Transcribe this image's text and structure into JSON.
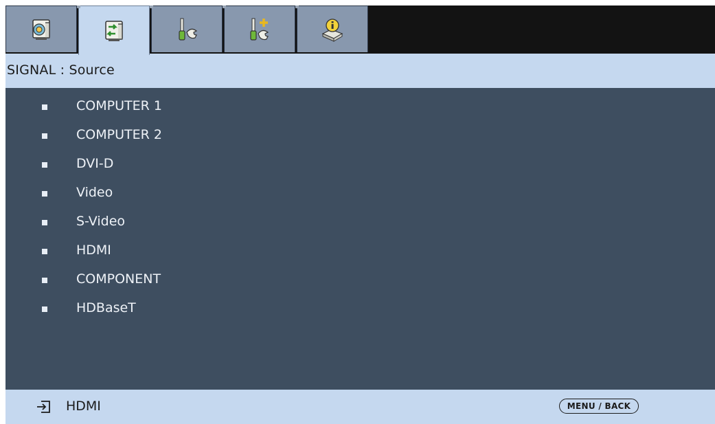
{
  "tabs": [
    {
      "name": "tab-image",
      "icon": "image-settings-icon",
      "active": false
    },
    {
      "name": "tab-signal",
      "icon": "signal-settings-icon",
      "active": true
    },
    {
      "name": "tab-setup",
      "icon": "setup-tools-icon",
      "active": false
    },
    {
      "name": "tab-extended",
      "icon": "extended-setup-icon",
      "active": false
    },
    {
      "name": "tab-information",
      "icon": "information-icon",
      "active": false
    }
  ],
  "header": {
    "title": "SIGNAL : Source"
  },
  "sources": [
    {
      "label": "COMPUTER 1"
    },
    {
      "label": "COMPUTER 2"
    },
    {
      "label": "DVI-D"
    },
    {
      "label": "Video"
    },
    {
      "label": "S-Video"
    },
    {
      "label": "HDMI"
    },
    {
      "label": "COMPONENT"
    },
    {
      "label": "HDBaseT"
    }
  ],
  "status": {
    "input_icon": "input-source-icon",
    "current_input": "HDMI",
    "menu_back": "MENU / BACK"
  },
  "colors": {
    "panel": "#3e4e60",
    "header": "#c5d8ef",
    "tab_inactive": "#8898ae",
    "tab_bar": "#131313"
  }
}
